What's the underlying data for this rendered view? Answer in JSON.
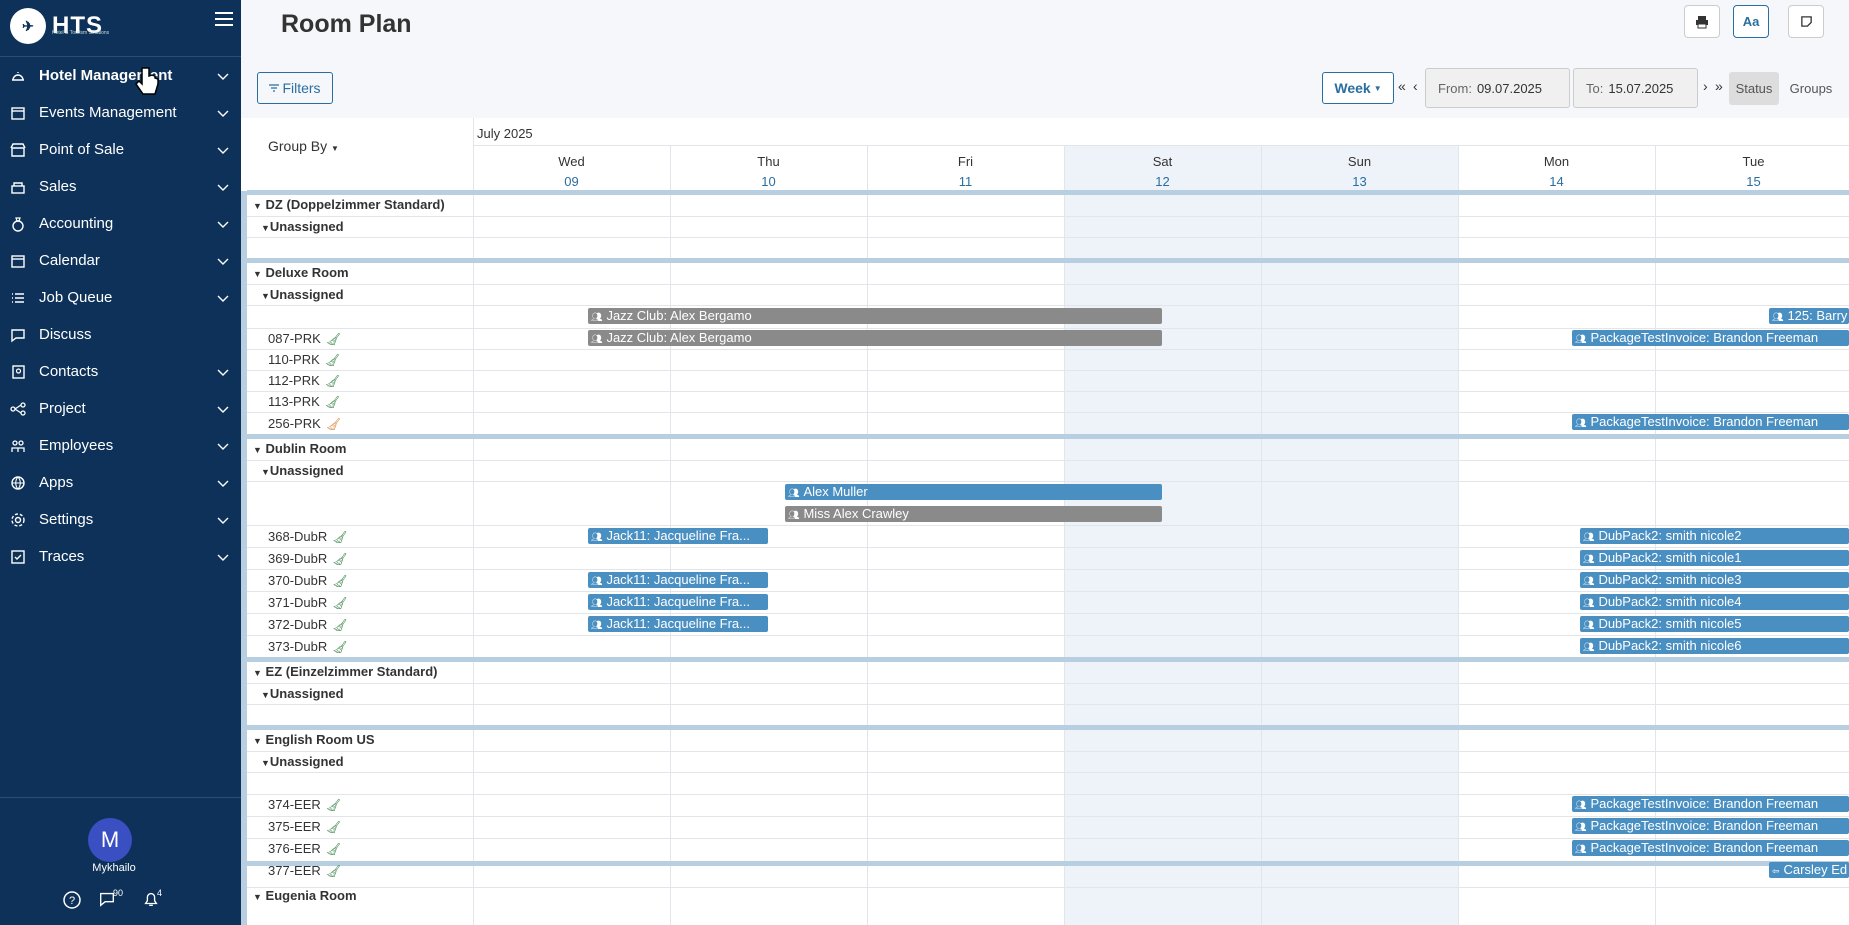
{
  "sidebar": {
    "logo": "HTS",
    "logo_sub": "Hotel & Tourism Solutions",
    "items": [
      {
        "label": "Hotel Management",
        "icon": "bell-icon"
      },
      {
        "label": "Events Management",
        "icon": "calendar-icon"
      },
      {
        "label": "Point of Sale",
        "icon": "store-icon"
      },
      {
        "label": "Sales",
        "icon": "sales-icon"
      },
      {
        "label": "Accounting",
        "icon": "money-bag-icon"
      },
      {
        "label": "Calendar",
        "icon": "calendar-icon"
      },
      {
        "label": "Job Queue",
        "icon": "list-icon"
      },
      {
        "label": "Discuss",
        "icon": "chat-icon"
      },
      {
        "label": "Contacts",
        "icon": "contact-icon"
      },
      {
        "label": "Project",
        "icon": "project-icon"
      },
      {
        "label": "Employees",
        "icon": "employees-icon"
      },
      {
        "label": "Apps",
        "icon": "globe-icon"
      },
      {
        "label": "Settings",
        "icon": "gear-icon"
      },
      {
        "label": "Traces",
        "icon": "check-square-icon"
      }
    ],
    "user": {
      "initial": "M",
      "name": "Mykhailo"
    },
    "messages_count": "90",
    "notifications_count": "4"
  },
  "header": {
    "title": "Room Plan",
    "font_btn": "Aa"
  },
  "toolbar": {
    "filters": "Filters",
    "period": "Week",
    "from_label": "From:",
    "from": "09.07.2025",
    "to_label": "To:",
    "to": "15.07.2025",
    "status": "Status",
    "groups": "Groups"
  },
  "grid": {
    "group_by": "Group By",
    "month": "July 2025",
    "days": [
      {
        "d": "Wed",
        "n": "09"
      },
      {
        "d": "Thu",
        "n": "10"
      },
      {
        "d": "Fri",
        "n": "11"
      },
      {
        "d": "Sat",
        "n": "12"
      },
      {
        "d": "Sun",
        "n": "13"
      },
      {
        "d": "Mon",
        "n": "14"
      },
      {
        "d": "Tue",
        "n": "15"
      }
    ],
    "unassigned": "Unassigned",
    "categories": [
      "DZ (Doppelzimmer Standard)",
      "Deluxe Room",
      "Dublin Room",
      "EZ (Einzelzimmer Standard)",
      "English Room US",
      "Eugenia Room"
    ],
    "rooms": [
      "087-PRK",
      "110-PRK",
      "112-PRK",
      "113-PRK",
      "256-PRK",
      "368-DubR",
      "369-DubR",
      "370-DubR",
      "371-DubR",
      "372-DubR",
      "373-DubR",
      "374-EER",
      "375-EER",
      "376-EER",
      "377-EER"
    ],
    "bookings": [
      "Jazz Club: Alex Bergamo",
      "Jazz Club: Alex Bergamo",
      "125: Barry",
      "PackageTestInvoice: Brandon Freeman",
      "PackageTestInvoice: Brandon Freeman",
      "Alex Muller",
      "Miss Alex Crawley",
      "Jack11: Jacqueline Fra...",
      "DubPack2: smith nicole2",
      "DubPack2: smith nicole1",
      "Jack11: Jacqueline Fra...",
      "DubPack2: smith nicole3",
      "Jack11: Jacqueline Fra...",
      "DubPack2: smith nicole4",
      "Jack11: Jacqueline Fra...",
      "DubPack2: smith nicole5",
      "DubPack2: smith nicole6",
      "PackageTestInvoice: Brandon Freeman",
      "PackageTestInvoice: Brandon Freeman",
      "PackageTestInvoice: Brandon Freeman",
      "Carsley Ed"
    ]
  }
}
